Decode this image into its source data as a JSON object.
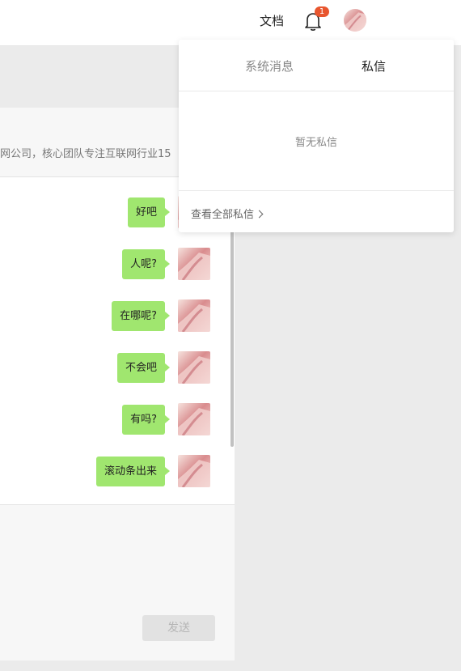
{
  "header": {
    "docs_label": "文档",
    "notification_count": "1"
  },
  "chat": {
    "description": "网公司，核心团队专注互联网行业15",
    "messages": [
      "好吧",
      "人呢?",
      "在哪呢?",
      "不会吧",
      "有吗?",
      "滚动条出来"
    ],
    "send_label": "发送"
  },
  "dropdown": {
    "tabs": [
      "系统消息",
      "私信"
    ],
    "active_tab": "私信",
    "empty_text": "暂无私信",
    "view_all_label": "查看全部私信"
  },
  "colors": {
    "bubble": "#a0e66f",
    "badge": "#e8552e",
    "page_background": "#ebebeb"
  }
}
